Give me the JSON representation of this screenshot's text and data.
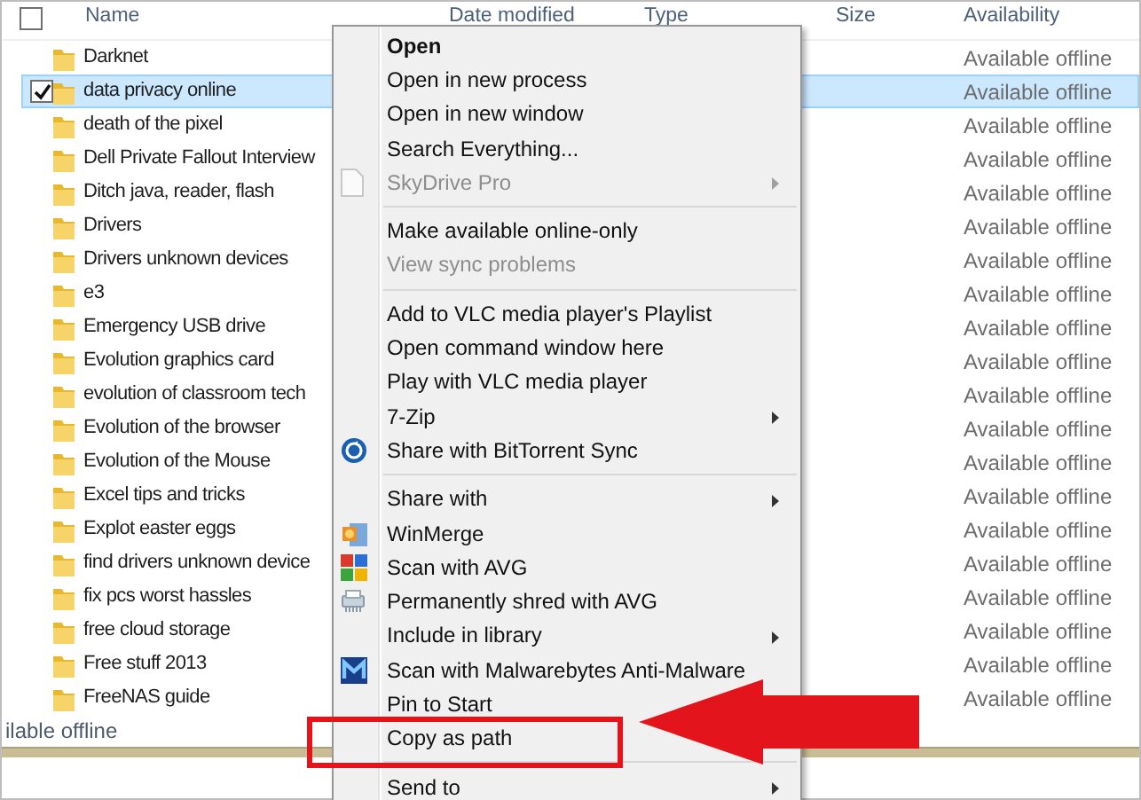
{
  "columns": [
    {
      "label": "Name"
    },
    {
      "label": "Date modified"
    },
    {
      "label": "Type"
    },
    {
      "label": "Size"
    },
    {
      "label": "Availability"
    }
  ],
  "header_checkbox": {
    "checked": false
  },
  "rows": [
    {
      "name": "Darknet",
      "availability": "Available offline",
      "selected": false
    },
    {
      "name": "data privacy online",
      "availability": "Available offline",
      "selected": true
    },
    {
      "name": "death of the pixel",
      "availability": "Available offline",
      "selected": false
    },
    {
      "name": "Dell Private Fallout Interview",
      "availability": "Available offline",
      "selected": false
    },
    {
      "name": "Ditch java, reader, flash",
      "availability": "Available offline",
      "selected": false
    },
    {
      "name": "Drivers",
      "availability": "Available offline",
      "selected": false
    },
    {
      "name": "Drivers unknown devices",
      "availability": "Available offline",
      "selected": false
    },
    {
      "name": "e3",
      "availability": "Available offline",
      "selected": false
    },
    {
      "name": "Emergency USB drive",
      "availability": "Available offline",
      "selected": false
    },
    {
      "name": "Evolution graphics card",
      "availability": "Available offline",
      "selected": false
    },
    {
      "name": "evolution of classroom tech",
      "availability": "Available offline",
      "selected": false
    },
    {
      "name": "Evolution of the browser",
      "availability": "Available offline",
      "selected": false
    },
    {
      "name": "Evolution of the Mouse",
      "availability": "Available offline",
      "selected": false
    },
    {
      "name": "Excel tips and tricks",
      "availability": "Available offline",
      "selected": false
    },
    {
      "name": "Explot easter eggs",
      "availability": "Available offline",
      "selected": false
    },
    {
      "name": "find drivers unknown device",
      "availability": "Available offline",
      "selected": false
    },
    {
      "name": "fix pcs worst hassles",
      "availability": "Available offline",
      "selected": false
    },
    {
      "name": "free cloud storage",
      "availability": "Available offline",
      "selected": false
    },
    {
      "name": "Free stuff 2013",
      "availability": "Available offline",
      "selected": false
    },
    {
      "name": "FreeNAS guide",
      "availability": "Available offline",
      "selected": false
    }
  ],
  "status_text": "ilable offline",
  "context_menu": {
    "items": [
      {
        "kind": "item",
        "label": "Open",
        "bold": true,
        "disabled": false,
        "submenu": false
      },
      {
        "kind": "item",
        "label": "Open in new process",
        "bold": false,
        "disabled": false,
        "submenu": false
      },
      {
        "kind": "item",
        "label": "Open in new window",
        "bold": false,
        "disabled": false,
        "submenu": false
      },
      {
        "kind": "item",
        "label": "Search Everything...",
        "bold": false,
        "disabled": false,
        "submenu": false
      },
      {
        "kind": "item",
        "label": "SkyDrive Pro",
        "bold": false,
        "disabled": true,
        "submenu": true
      },
      {
        "kind": "separator"
      },
      {
        "kind": "item",
        "label": "Make available online-only",
        "bold": false,
        "disabled": false,
        "submenu": false
      },
      {
        "kind": "item",
        "label": "View sync problems",
        "bold": false,
        "disabled": true,
        "submenu": false
      },
      {
        "kind": "separator"
      },
      {
        "kind": "item",
        "label": "Add to VLC media player's Playlist",
        "bold": false,
        "disabled": false,
        "submenu": false
      },
      {
        "kind": "item",
        "label": "Open command window here",
        "bold": false,
        "disabled": false,
        "submenu": false
      },
      {
        "kind": "item",
        "label": "Play with VLC media player",
        "bold": false,
        "disabled": false,
        "submenu": false
      },
      {
        "kind": "item",
        "label": "7-Zip",
        "bold": false,
        "disabled": false,
        "submenu": true
      },
      {
        "kind": "item",
        "label": "Share with BitTorrent Sync",
        "bold": false,
        "disabled": false,
        "submenu": false
      },
      {
        "kind": "separator"
      },
      {
        "kind": "item",
        "label": "Share with",
        "bold": false,
        "disabled": false,
        "submenu": true
      },
      {
        "kind": "item",
        "label": "WinMerge",
        "bold": false,
        "disabled": false,
        "submenu": false
      },
      {
        "kind": "item",
        "label": "Scan with AVG",
        "bold": false,
        "disabled": false,
        "submenu": false
      },
      {
        "kind": "item",
        "label": "Permanently shred with AVG",
        "bold": false,
        "disabled": false,
        "submenu": false
      },
      {
        "kind": "item",
        "label": "Include in library",
        "bold": false,
        "disabled": false,
        "submenu": true
      },
      {
        "kind": "item",
        "label": "Scan with Malwarebytes Anti-Malware",
        "bold": false,
        "disabled": false,
        "submenu": false
      },
      {
        "kind": "item",
        "label": "Pin to Start",
        "bold": false,
        "disabled": false,
        "submenu": false
      },
      {
        "kind": "item",
        "label": "Copy as path",
        "bold": false,
        "disabled": false,
        "submenu": false
      },
      {
        "kind": "separator"
      },
      {
        "kind": "item",
        "label": "Send to",
        "bold": false,
        "disabled": false,
        "submenu": true
      }
    ]
  }
}
